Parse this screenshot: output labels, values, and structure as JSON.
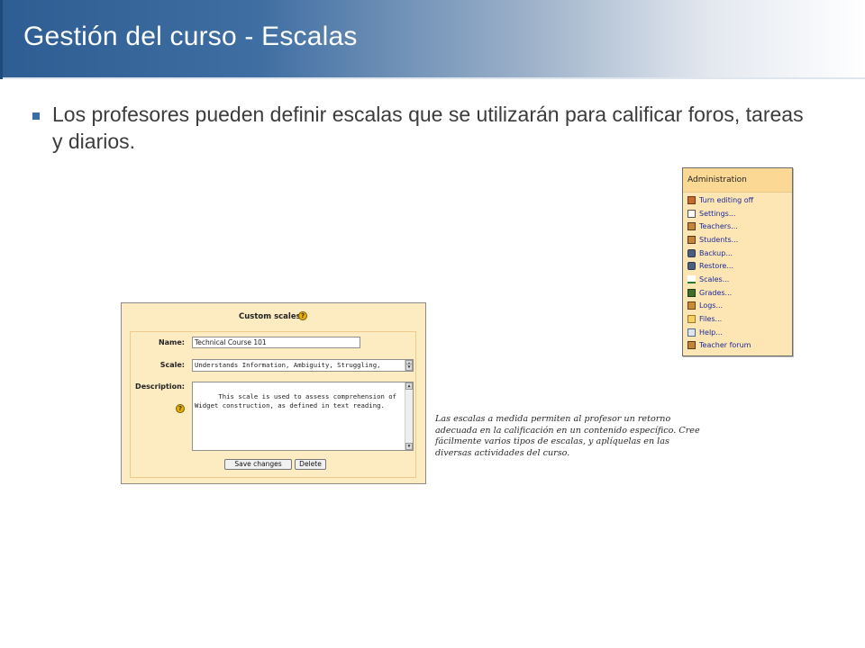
{
  "slide": {
    "title": "Gestión del curso - Escalas",
    "bullet": "Los profesores pueden definir escalas que se utilizarán para calificar foros, tareas y diarios."
  },
  "admin_panel": {
    "title": "Administration",
    "items": [
      {
        "label": "Turn editing off",
        "icon": "edit-icon"
      },
      {
        "label": "Settings...",
        "icon": "settings-icon"
      },
      {
        "label": "Teachers...",
        "icon": "teachers-icon"
      },
      {
        "label": "Students...",
        "icon": "students-icon"
      },
      {
        "label": "Backup...",
        "icon": "backup-icon"
      },
      {
        "label": "Restore...",
        "icon": "restore-icon"
      },
      {
        "label": "Scales...",
        "icon": "scales-icon"
      },
      {
        "label": "Grades...",
        "icon": "grades-icon"
      },
      {
        "label": "Logs...",
        "icon": "logs-icon"
      },
      {
        "label": "Files...",
        "icon": "folder-icon"
      },
      {
        "label": "Help...",
        "icon": "help-icon"
      },
      {
        "label": "Teacher forum",
        "icon": "forum-icon"
      }
    ]
  },
  "scale_form": {
    "title": "Custom scales",
    "help_glyph": "?",
    "name_label": "Name:",
    "name_value": "Technical Course 101",
    "scale_label": "Scale:",
    "scale_value": "Understands Information, Ambiguity, Struggling,",
    "description_label": "Description:",
    "description_value": "This scale is used to assess comprehension of\nWidget construction, as defined in text reading.",
    "save_label": "Save changes",
    "delete_label": "Delete"
  },
  "caption": "Las escalas a medida permiten al profesor un retorno adecuada en la calificación en un contenido específico. Cree fácilmente varios tipos de escalas, y aplíquelas en las diversas actividades del curso."
}
